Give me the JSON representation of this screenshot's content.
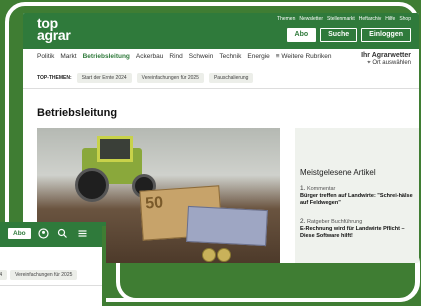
{
  "header": {
    "logo": "top agrar",
    "top_links": [
      "Themen",
      "Newsletter",
      "Stellenmarkt",
      "Heftarchiv",
      "Hilfe",
      "Shop"
    ],
    "abo_label": "Abo",
    "search_label": "Suche",
    "login_label": "Einloggen"
  },
  "nav": {
    "items": [
      "Politik",
      "Markt",
      "Betriebsleitung",
      "Ackerbau",
      "Rind",
      "Schwein",
      "Technik",
      "Energie"
    ],
    "more_label": "≡ Weitere Rubriken",
    "active": "Betriebsleitung"
  },
  "weather": {
    "title": "Ihr Agrarwetter",
    "location": "Ort auswählen"
  },
  "topics": {
    "label": "TOP-THEMEN:",
    "chips": [
      "Start der Ernte 2024",
      "Vereinfachungen für 2025",
      "Pauschalierung"
    ]
  },
  "page": {
    "title": "Betriebsleitung"
  },
  "hero": {
    "banknote": "50"
  },
  "sidebar": {
    "heading": "Meistgelesene Artikel",
    "articles": [
      {
        "num": "1.",
        "category": "Kommentar",
        "title": "Bürger treffen auf Landwirte: \"Schrei-hälse auf Feldwegen\""
      },
      {
        "num": "2.",
        "category": "Ratgeber Buchführung",
        "title": "E-Rechnung wird für Landwirte Pflicht – Diese Software hilft!"
      }
    ]
  },
  "mobile": {
    "abo_label": "Abo",
    "chips": [
      "2024",
      "Vereinfachungen für 2025"
    ]
  },
  "colors": {
    "brand_green": "#2f7a3b",
    "background_green": "#3f7d33"
  },
  "icons": {
    "weather_location": "location-pin-icon",
    "mobile_user": "user-circle-icon",
    "mobile_search": "search-icon",
    "mobile_menu": "hamburger-menu-icon"
  }
}
